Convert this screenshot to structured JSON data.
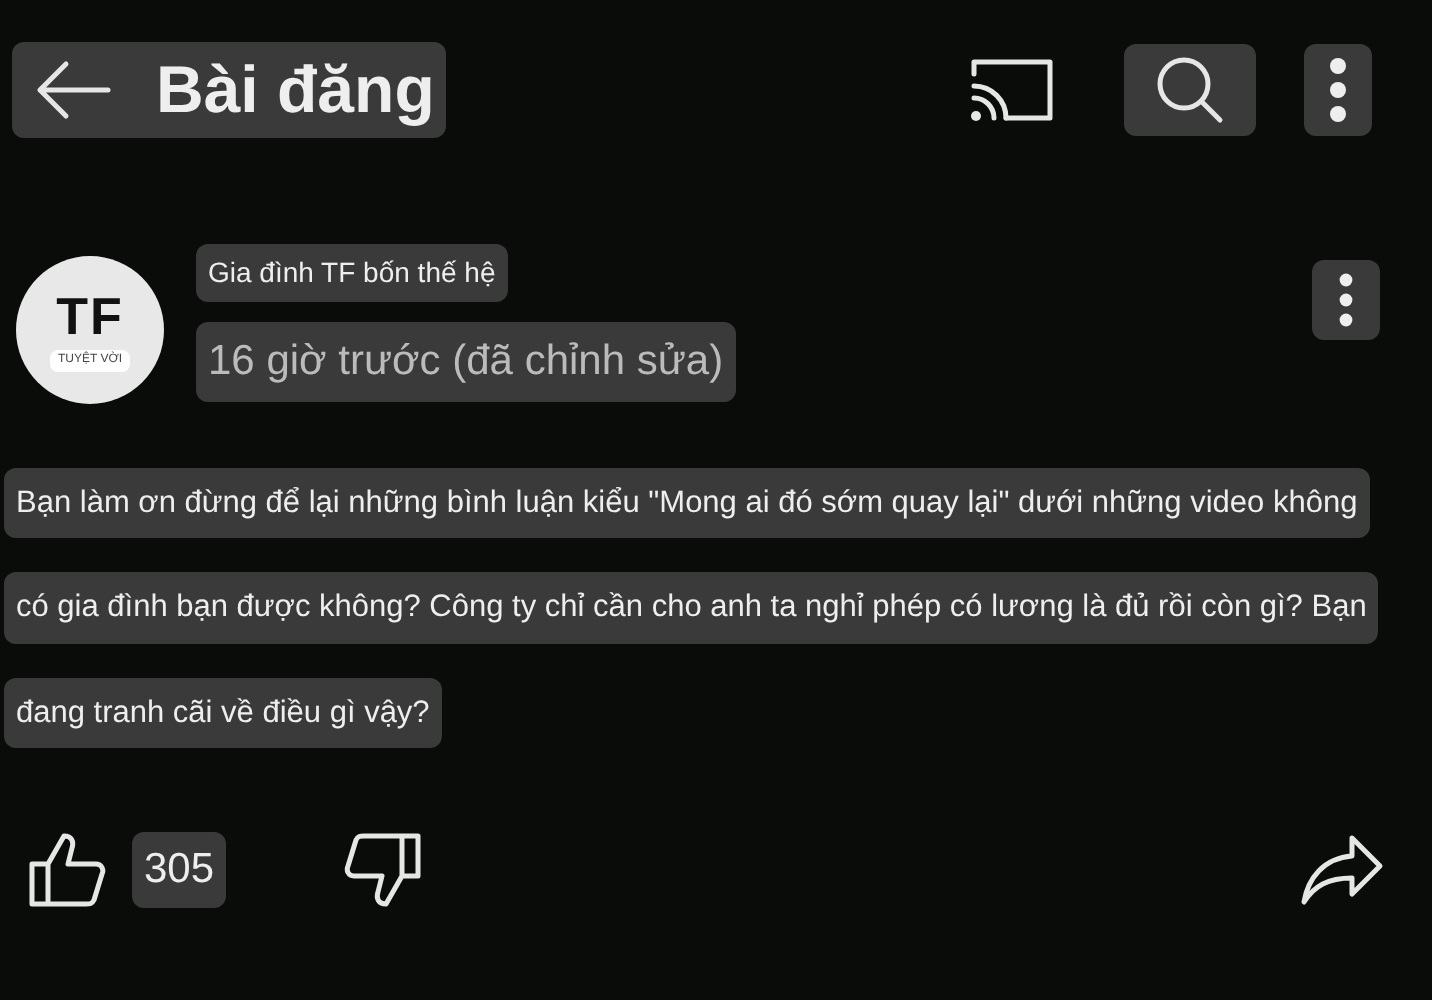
{
  "header": {
    "title": "Bài đăng"
  },
  "post": {
    "avatar": {
      "logo": "TF",
      "badge": "TUYỆT VỜI"
    },
    "author": "Gia đình TF bốn thế hệ",
    "time": "16 giờ trước (đã chỉnh sửa)",
    "text_lines": [
      "Bạn làm ơn đừng để lại những bình luận kiểu \"Mong ai đó sớm quay lại\" dưới những video không",
      "có gia đình bạn được không? Công ty chỉ cần cho anh ta nghỉ phép có lương là đủ rồi còn gì? Bạn",
      "đang tranh cãi về điều gì vậy?"
    ],
    "likes": "305"
  }
}
